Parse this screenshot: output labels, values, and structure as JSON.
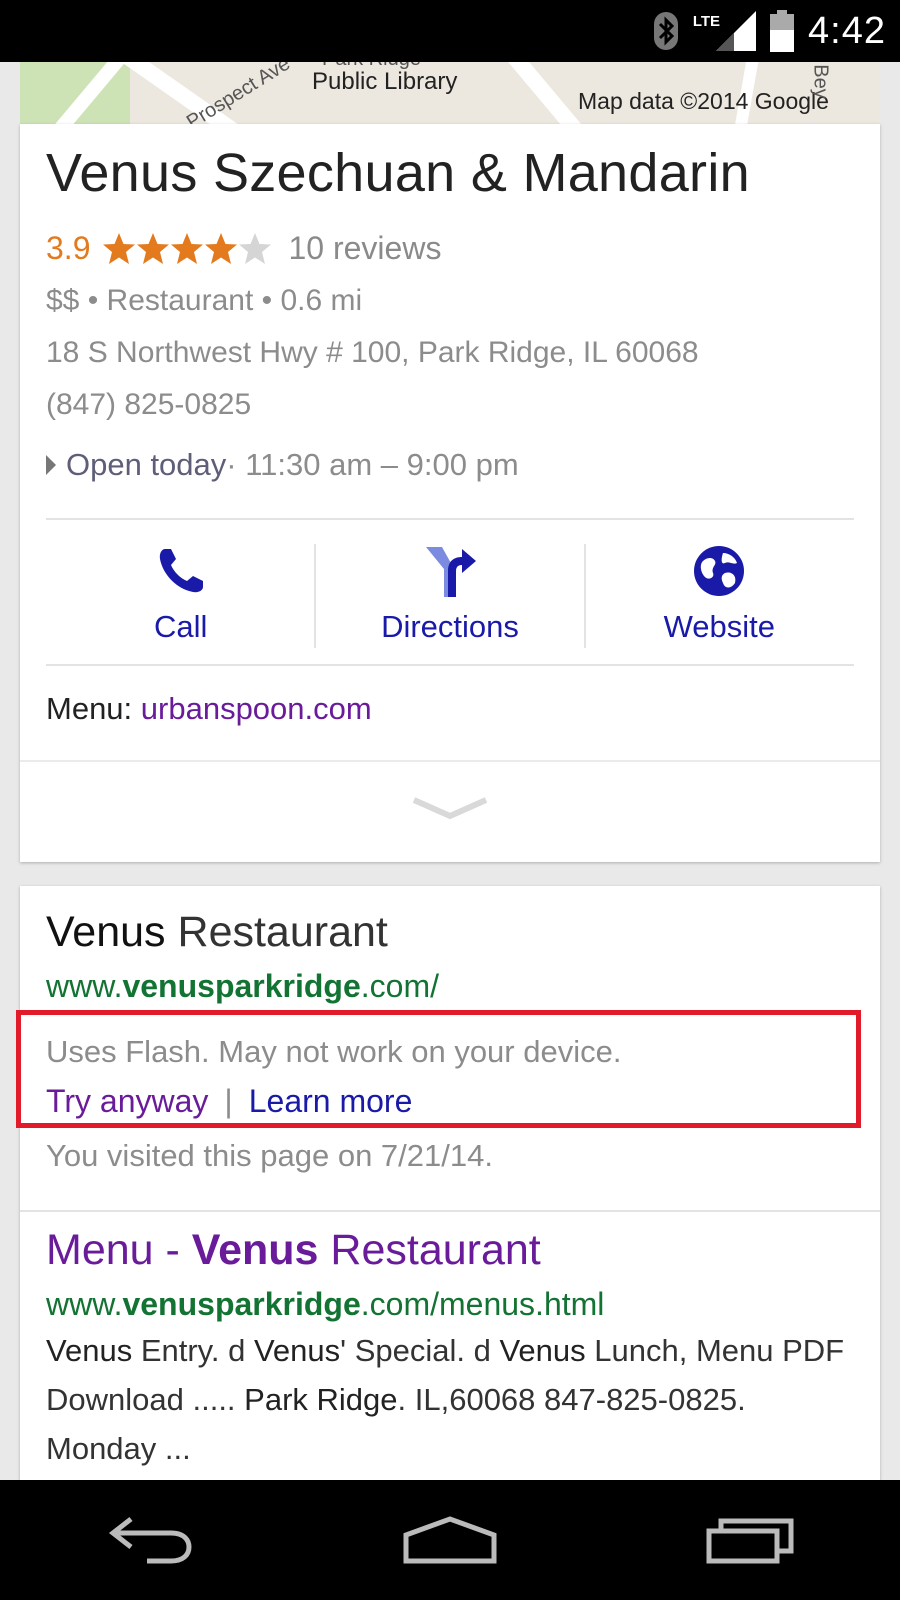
{
  "status_bar": {
    "network": "LTE",
    "time": "4:42"
  },
  "map": {
    "library_label_top": "Park Ridge",
    "library_label": "Public Library",
    "street_label": "Prospect Ave",
    "attribution": "Map data ©2014 Google",
    "right_label": "Bey"
  },
  "place_card": {
    "name": "Venus Szechuan & Mandarin",
    "rating": "3.9",
    "stars_filled": 4,
    "stars_total": 5,
    "reviews": "10 reviews",
    "details": "$$ • Restaurant • 0.6 mi",
    "address": "18 S Northwest Hwy # 100, Park Ridge, IL 60068",
    "phone": "(847) 825-0825",
    "hours_status": "Open today",
    "hours_range": " · 11:30 am – 9:00 pm",
    "actions": {
      "call": "Call",
      "directions": "Directions",
      "website": "Website"
    },
    "menu_label": "Menu: ",
    "menu_link": "urbanspoon.com"
  },
  "results": [
    {
      "title_bold": "Venus",
      "title_rest": " Restaurant",
      "url_prefix": "www.",
      "url_bold": "venusparkridge",
      "url_suffix": ".com/",
      "flash_note": "Uses Flash. May not work on your device.",
      "try_anyway": "Try anyway",
      "separator": "|",
      "learn_more": "Learn more",
      "visited": "You visited this page on 7/21/14."
    },
    {
      "title_pre": "Menu - ",
      "title_bold": "Venus",
      "title_rest": " Restaurant",
      "url_prefix": "www.",
      "url_bold": "venusparkridge",
      "url_suffix": ".com/menus.html",
      "snippet": {
        "b1": "Venus",
        "t1": " Entry. d ",
        "b2": "Venus",
        "t2": "' Special. d ",
        "b3": "Venus",
        "t3": " Lunch, Menu PDF Download ..... ",
        "b4": "Park Ridge",
        "t4": ". IL,60068 847-825-0825. Monday ..."
      }
    }
  ],
  "colors": {
    "rating_orange": "#e37b1e",
    "link_blue": "#1a1aa8",
    "visited_purple": "#6a1b9a",
    "url_green": "#137333",
    "highlight_red": "#e21b2b"
  },
  "icons": [
    "bluetooth-icon",
    "signal-icon",
    "battery-icon",
    "phone-icon",
    "directions-icon",
    "globe-icon",
    "chevron-down-icon",
    "back-icon",
    "home-icon",
    "recents-icon"
  ]
}
